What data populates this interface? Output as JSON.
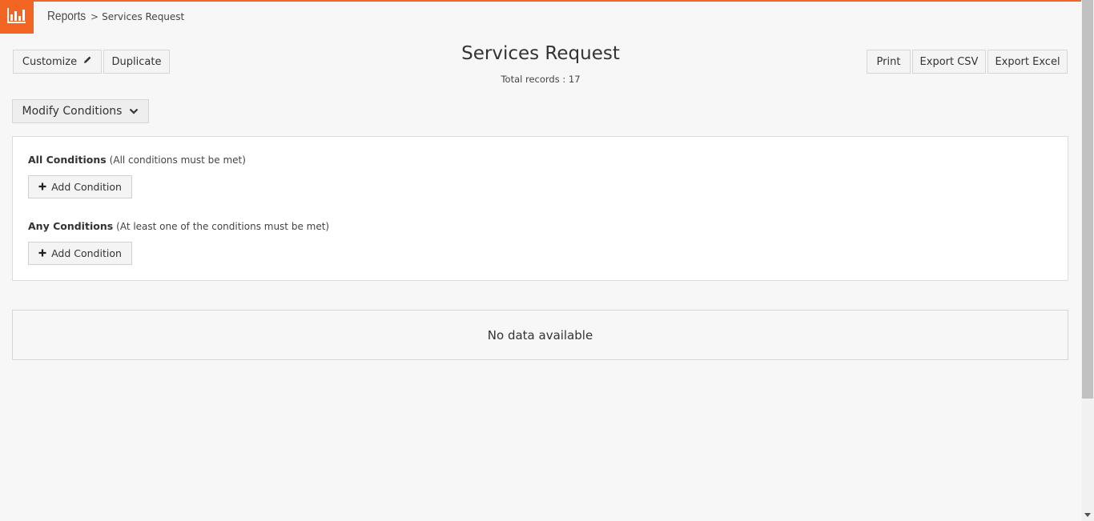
{
  "header": {
    "breadcrumb_root": "Reports",
    "breadcrumb_separator": ">",
    "breadcrumb_current": "Services Request",
    "brand_color": "#f26522"
  },
  "toolbar": {
    "customize_label": "Customize",
    "duplicate_label": "Duplicate",
    "print_label": "Print",
    "export_csv_label": "Export CSV",
    "export_excel_label": "Export Excel"
  },
  "report": {
    "title": "Services Request",
    "total_records": "Total records : 17"
  },
  "conditions": {
    "modify_label": "Modify Conditions",
    "all_title": "All Conditions",
    "all_hint": "(All conditions must be met)",
    "any_title": "Any Conditions",
    "any_hint": "(At least one of the conditions must be met)",
    "add_label": "Add Condition"
  },
  "results": {
    "empty_message": "No data available"
  },
  "icons": {
    "logo": "bar-chart-icon",
    "customize": "pencil-icon",
    "modify": "chevron-down-icon",
    "add": "plus-icon"
  }
}
